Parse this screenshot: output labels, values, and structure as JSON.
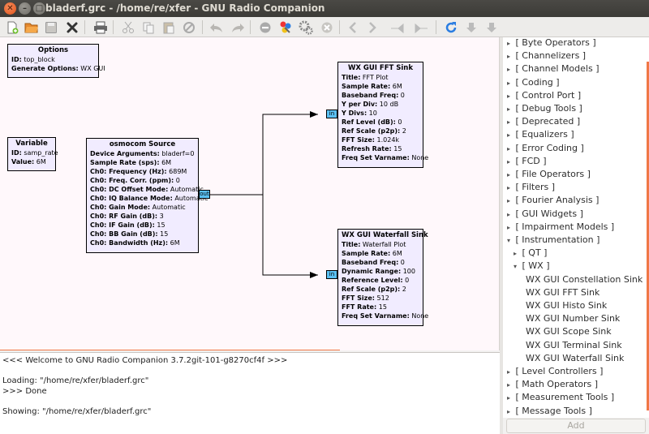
{
  "window": {
    "title": "bladerf.grc - /home/re/xfer - GNU Radio Companion",
    "close_glyph": "✕",
    "min_glyph": "–",
    "max_glyph": "□"
  },
  "toolbar": {
    "icons": [
      "new-icon",
      "open-icon",
      "save-icon",
      "close-icon",
      "print-icon",
      "cut-icon",
      "copy-icon",
      "paste-icon",
      "delete-icon",
      "undo-icon",
      "redo-icon",
      "disable-icon",
      "generate-icon",
      "execute-icon",
      "kill-icon",
      "rotate-left-icon",
      "rotate-right-icon",
      "enable-icon",
      "bypass-icon",
      "reload-icon",
      "find-icon",
      "help-icon"
    ]
  },
  "blocks": {
    "options": {
      "title": "Options",
      "params": [
        {
          "key": "ID:",
          "value": " top_block"
        },
        {
          "key": "Generate Options:",
          "value": " WX GUI"
        }
      ]
    },
    "variable": {
      "title": "Variable",
      "params": [
        {
          "key": "ID:",
          "value": " samp_rate"
        },
        {
          "key": "Value:",
          "value": " 6M"
        }
      ]
    },
    "osmocom": {
      "title": "osmocom Source",
      "port_out": "out",
      "params": [
        {
          "key": "Device Arguments:",
          "value": " bladerf=0"
        },
        {
          "key": "Sample Rate (sps):",
          "value": " 6M"
        },
        {
          "key": "Ch0: Frequency (Hz):",
          "value": " 689M"
        },
        {
          "key": "Ch0: Freq. Corr. (ppm):",
          "value": " 0"
        },
        {
          "key": "Ch0: DC Offset Mode:",
          "value": " Automatic"
        },
        {
          "key": "Ch0: IQ Balance Mode:",
          "value": " Automatic"
        },
        {
          "key": "Ch0: Gain Mode:",
          "value": " Automatic"
        },
        {
          "key": "Ch0: RF Gain (dB):",
          "value": " 3"
        },
        {
          "key": "Ch0: IF Gain (dB):",
          "value": " 15"
        },
        {
          "key": "Ch0: BB Gain (dB):",
          "value": " 15"
        },
        {
          "key": "Ch0: Bandwidth (Hz):",
          "value": " 6M"
        }
      ]
    },
    "fft": {
      "title": "WX GUI FFT Sink",
      "port_in": "in",
      "params": [
        {
          "key": "Title:",
          "value": " FFT Plot"
        },
        {
          "key": "Sample Rate:",
          "value": " 6M"
        },
        {
          "key": "Baseband Freq:",
          "value": " 0"
        },
        {
          "key": "Y per Div:",
          "value": " 10 dB"
        },
        {
          "key": "Y Divs:",
          "value": " 10"
        },
        {
          "key": "Ref Level (dB):",
          "value": " 0"
        },
        {
          "key": "Ref Scale (p2p):",
          "value": " 2"
        },
        {
          "key": "FFT Size:",
          "value": " 1.024k"
        },
        {
          "key": "Refresh Rate:",
          "value": " 15"
        },
        {
          "key": "Freq Set Varname:",
          "value": " None"
        }
      ]
    },
    "waterfall": {
      "title": "WX GUI Waterfall Sink",
      "port_in": "in",
      "params": [
        {
          "key": "Title:",
          "value": " Waterfall Plot"
        },
        {
          "key": "Sample Rate:",
          "value": " 6M"
        },
        {
          "key": "Baseband Freq:",
          "value": " 0"
        },
        {
          "key": "Dynamic Range:",
          "value": " 100"
        },
        {
          "key": "Reference Level:",
          "value": " 0"
        },
        {
          "key": "Ref Scale (p2p):",
          "value": " 2"
        },
        {
          "key": "FFT Size:",
          "value": " 512"
        },
        {
          "key": "FFT Rate:",
          "value": " 15"
        },
        {
          "key": "Freq Set Varname:",
          "value": " None"
        }
      ]
    }
  },
  "console": {
    "lines": [
      "<<< Welcome to GNU Radio Companion 3.7.2git-101-g8270cf4f >>>",
      "",
      "Loading: \"/home/re/xfer/bladerf.grc\"",
      ">>> Done",
      "",
      "Showing: \"/home/re/xfer/bladerf.grc\""
    ]
  },
  "tree": {
    "items": [
      {
        "label": "[ Byte Operators ]",
        "level": 0,
        "arrow": "▸"
      },
      {
        "label": "[ Channelizers ]",
        "level": 0,
        "arrow": "▸"
      },
      {
        "label": "[ Channel Models ]",
        "level": 0,
        "arrow": "▸"
      },
      {
        "label": "[ Coding ]",
        "level": 0,
        "arrow": "▸"
      },
      {
        "label": "[ Control Port ]",
        "level": 0,
        "arrow": "▸"
      },
      {
        "label": "[ Debug Tools ]",
        "level": 0,
        "arrow": "▸"
      },
      {
        "label": "[ Deprecated ]",
        "level": 0,
        "arrow": "▸"
      },
      {
        "label": "[ Equalizers ]",
        "level": 0,
        "arrow": "▸"
      },
      {
        "label": "[ Error Coding ]",
        "level": 0,
        "arrow": "▸"
      },
      {
        "label": "[ FCD ]",
        "level": 0,
        "arrow": "▸"
      },
      {
        "label": "[ File Operators ]",
        "level": 0,
        "arrow": "▸"
      },
      {
        "label": "[ Filters ]",
        "level": 0,
        "arrow": "▸"
      },
      {
        "label": "[ Fourier Analysis ]",
        "level": 0,
        "arrow": "▸"
      },
      {
        "label": "[ GUI Widgets ]",
        "level": 0,
        "arrow": "▸"
      },
      {
        "label": "[ Impairment Models ]",
        "level": 0,
        "arrow": "▸"
      },
      {
        "label": "[ Instrumentation ]",
        "level": 0,
        "arrow": "▾"
      },
      {
        "label": "[ QT ]",
        "level": 1,
        "arrow": "▸"
      },
      {
        "label": "[ WX ]",
        "level": 1,
        "arrow": "▾"
      },
      {
        "label": "WX GUI Constellation Sink",
        "level": 2,
        "arrow": ""
      },
      {
        "label": "WX GUI FFT Sink",
        "level": 2,
        "arrow": ""
      },
      {
        "label": "WX GUI Histo Sink",
        "level": 2,
        "arrow": ""
      },
      {
        "label": "WX GUI Number Sink",
        "level": 2,
        "arrow": ""
      },
      {
        "label": "WX GUI Scope Sink",
        "level": 2,
        "arrow": ""
      },
      {
        "label": "WX GUI Terminal Sink",
        "level": 2,
        "arrow": ""
      },
      {
        "label": "WX GUI Waterfall Sink",
        "level": 2,
        "arrow": ""
      },
      {
        "label": "[ Level Controllers ]",
        "level": 0,
        "arrow": "▸"
      },
      {
        "label": "[ Math Operators ]",
        "level": 0,
        "arrow": "▸"
      },
      {
        "label": "[ Measurement Tools ]",
        "level": 0,
        "arrow": "▸"
      },
      {
        "label": "[ Message Tools ]",
        "level": 0,
        "arrow": "▸"
      }
    ],
    "add_label": "Add"
  },
  "colors": {
    "block_fill": "#f1ecff",
    "port_fill": "#5ac0f2",
    "accent": "#f07746",
    "canvas_bg": "#fff8fb"
  }
}
